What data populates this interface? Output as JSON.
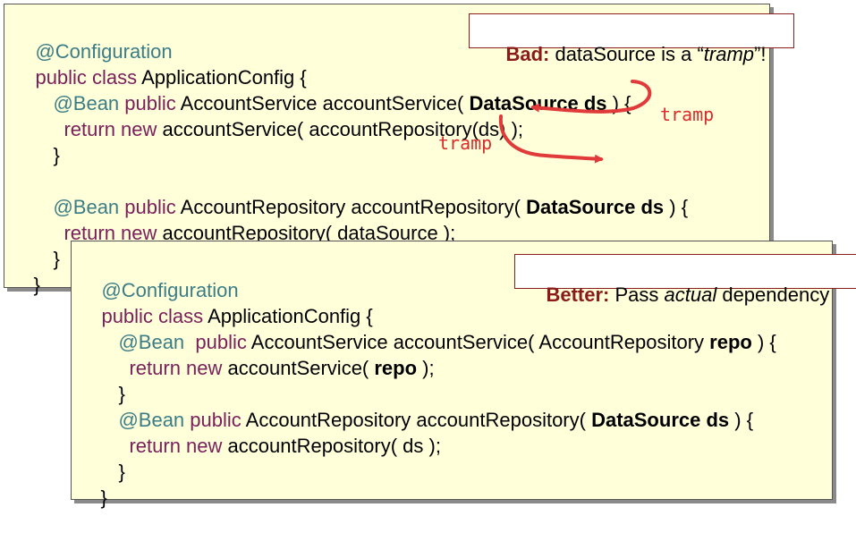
{
  "bad_panel": {
    "line1": {
      "annotation": "@Configuration"
    },
    "line2": {
      "kw": "public class",
      "rest": " ApplicationConfig {"
    },
    "line3": {
      "annotation": "@Bean",
      "kw": " public",
      "mid": " AccountService accountService( ",
      "bold": "DataSource ds",
      "end": " ) {"
    },
    "line4": {
      "kw": "return new",
      "rest": " accountService( accountRepository(ds) );"
    },
    "line5": {
      "text": "}"
    },
    "line6": {
      "annotation": "@Bean",
      "kw": " public",
      "mid": " AccountRepository accountRepository( ",
      "bold": "DataSource ds",
      "end": " ) {"
    },
    "line7": {
      "kw": "return new",
      "rest": " accountRepository( dataSource );"
    },
    "line8": {
      "text": "}"
    },
    "line9": {
      "text": "}"
    },
    "callout": {
      "label": "Bad:",
      "pre": " dataSource is a “",
      "italic": "tramp",
      "post": "”!"
    },
    "tramp_label_1": "tramp",
    "tramp_label_2": "tramp"
  },
  "better_panel": {
    "line1": {
      "annotation": "@Configuration"
    },
    "line2": {
      "kw": "public class",
      "rest": " ApplicationConfig {"
    },
    "line3": {
      "annotation": "@Bean",
      "kw": "  public",
      "mid": " AccountService accountService( AccountRepository ",
      "bold": "repo",
      "end": " ) {"
    },
    "line4": {
      "kw": "return new",
      "mid": " accountService( ",
      "bold": "repo",
      "end": " );"
    },
    "line5": {
      "text": "}"
    },
    "line6": {
      "annotation": "@Bean",
      "kw": " public",
      "mid": " AccountRepository accountRepository( ",
      "bold": "DataSource ds",
      "end": " ) {"
    },
    "line7": {
      "kw": "return new",
      "rest": " accountRepository( ds );"
    },
    "line8": {
      "text": "}"
    },
    "line9": {
      "text": "}"
    },
    "callout": {
      "label": "Better:",
      "pre": " Pass ",
      "italic": "actual",
      "post": " dependency"
    }
  },
  "colors": {
    "panel_bg": "#ffffd9",
    "annotation": "#3b7d87",
    "keyword": "#7a1f5c",
    "arrow": "#e03a3a",
    "callout_label": "#8b1a1a"
  }
}
